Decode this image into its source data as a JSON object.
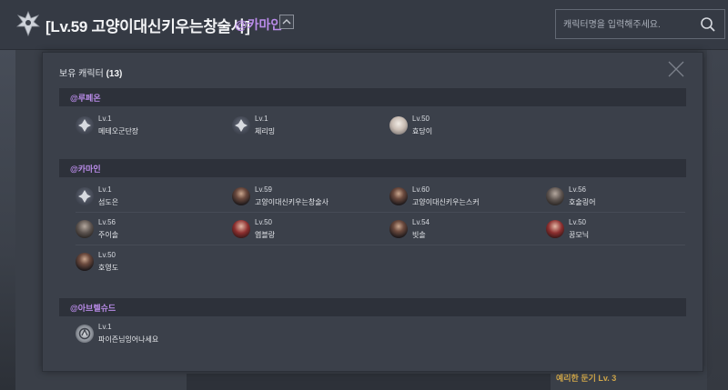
{
  "header": {
    "title": "[Lv.59 고양이대신키우는창술사]",
    "server": "@카마인",
    "search_placeholder": "캐릭터명을 입력해주세요.",
    "icons": {
      "logo": "lost-ark-emblem-icon",
      "toggle": "chevron-up-icon",
      "search": "search-icon"
    }
  },
  "background": {
    "visible_label": "예리한 둔기 Lv. 3"
  },
  "modal": {
    "title": "보유 캐릭터",
    "count": "(13)",
    "close_icon": "close-icon",
    "sections": [
      {
        "server": "@루페온",
        "characters": [
          {
            "level": "Lv.1",
            "name": "메테오군단장",
            "avatar": "class-emblem"
          },
          {
            "level": "Lv.1",
            "name": "체리밍",
            "avatar": "class-emblem"
          },
          {
            "level": "Lv.50",
            "name": "효당이",
            "avatar": "portrait"
          }
        ]
      },
      {
        "server": "@카마인",
        "characters": [
          {
            "level": "Lv.1",
            "name": "섬도은",
            "avatar": "class-emblem"
          },
          {
            "level": "Lv.59",
            "name": "고양이대신키우는창술사",
            "avatar": "portrait"
          },
          {
            "level": "Lv.60",
            "name": "고양이대신키우는스커",
            "avatar": "portrait"
          },
          {
            "level": "Lv.56",
            "name": "호술링어",
            "avatar": "portrait"
          },
          {
            "level": "Lv.56",
            "name": "주이솔",
            "avatar": "portrait"
          },
          {
            "level": "Lv.50",
            "name": "엽블랑",
            "avatar": "portrait"
          },
          {
            "level": "Lv.54",
            "name": "빗솔",
            "avatar": "portrait"
          },
          {
            "level": "Lv.50",
            "name": "꿈모닉",
            "avatar": "portrait"
          },
          {
            "level": "Lv.50",
            "name": "호영도",
            "avatar": "portrait"
          }
        ]
      },
      {
        "server": "@아브렐슈드",
        "characters": [
          {
            "level": "Lv.1",
            "name": "파이즌님잉어나세요",
            "avatar": "specialist-emblem"
          }
        ]
      }
    ]
  },
  "colors": {
    "server_accent": "#b98be8",
    "background": "#3d424c",
    "section_header": "#2d313a",
    "label_gold": "#d2a84a"
  }
}
